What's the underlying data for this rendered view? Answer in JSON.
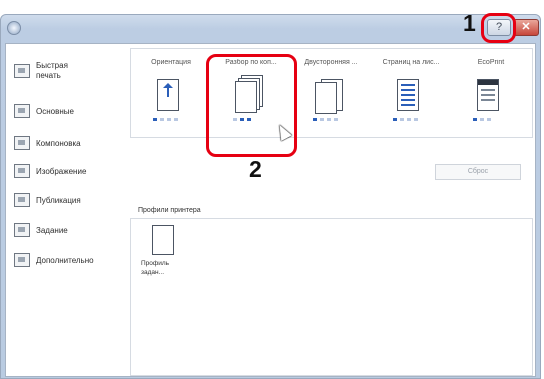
{
  "window": {
    "title": ""
  },
  "titlebar": {
    "help_label": "?",
    "close_label": "✕"
  },
  "sidebar": {
    "items": [
      {
        "label_line1": "Быстрая",
        "label_line2": "печать",
        "icon": "quick-print-icon"
      },
      {
        "label": "Основные",
        "icon": "basic-icon"
      },
      {
        "label": "Компоновка",
        "icon": "layout-icon"
      },
      {
        "label": "Изображение",
        "icon": "image-icon"
      },
      {
        "label": "Публикация",
        "icon": "publishing-icon"
      },
      {
        "label": "Задание",
        "icon": "job-icon"
      },
      {
        "label": "Дополнительно",
        "icon": "advanced-icon"
      }
    ]
  },
  "tiles": [
    {
      "caption": "Ориентация",
      "icon": "orientation-icon"
    },
    {
      "caption": "Разбор по коп...",
      "icon": "collate-icon"
    },
    {
      "caption": "Двусторонняя ...",
      "icon": "duplex-icon"
    },
    {
      "caption": "Страниц на лис...",
      "icon": "pages-per-sheet-icon"
    },
    {
      "caption": "EcoPrint",
      "icon": "ecoprint-icon"
    }
  ],
  "restore_button": {
    "label": "Сброс"
  },
  "profiles": {
    "label": "Профили принтера",
    "items": [
      {
        "name": "Профиль задан..."
      }
    ]
  },
  "callouts": [
    {
      "number": "1"
    },
    {
      "number": "2"
    }
  ],
  "colors": {
    "callout": "#e60012",
    "dot_active": "#2b5fb9"
  }
}
